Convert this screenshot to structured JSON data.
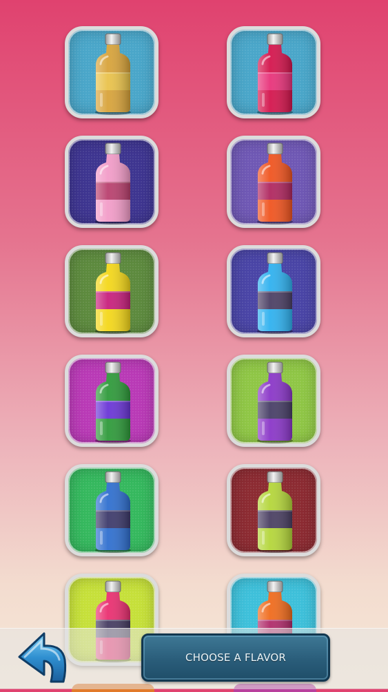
{
  "title_panel": {
    "label": "CHOOSE A FLAVOR"
  },
  "icons": {
    "back": "back-arrow-icon"
  },
  "colors": {
    "tile_border": "#dcdcdc",
    "panel": "#2a5d7a",
    "back_arrow": "#2f8fd0"
  },
  "flavors": [
    {
      "tile": "#4aa6c9",
      "liquid": "#d8a33a",
      "label": "#e9c24a"
    },
    {
      "tile": "#4aa6c9",
      "liquid": "#d4154d",
      "label": "#e8337a"
    },
    {
      "tile": "#3e3590",
      "liquid": "#f29cc8",
      "label": "#b9406e"
    },
    {
      "tile": "#6f58b4",
      "liquid": "#f0541f",
      "label": "#b0275f"
    },
    {
      "tile": "#5d8a3e",
      "liquid": "#f4d719",
      "label": "#c81f7c"
    },
    {
      "tile": "#4a45a6",
      "liquid": "#2fb1ef",
      "label": "#4b3f64"
    },
    {
      "tile": "#b93ab6",
      "liquid": "#2e9a3a",
      "label": "#6a35d6"
    },
    {
      "tile": "#8fc646",
      "liquid": "#8a36c8",
      "label": "#473e66"
    },
    {
      "tile": "#35b85e",
      "liquid": "#2f6fcf",
      "label": "#3d3a6b"
    },
    {
      "tile": "#8c2b32",
      "liquid": "#b4d63a",
      "label": "#4a3f62"
    },
    {
      "tile": "#c6e03a",
      "liquid": "#ea2f70",
      "label": "#453b61"
    },
    {
      "tile": "#3ec0da",
      "liquid": "#f06b1c",
      "label": "#b02b6a"
    }
  ]
}
